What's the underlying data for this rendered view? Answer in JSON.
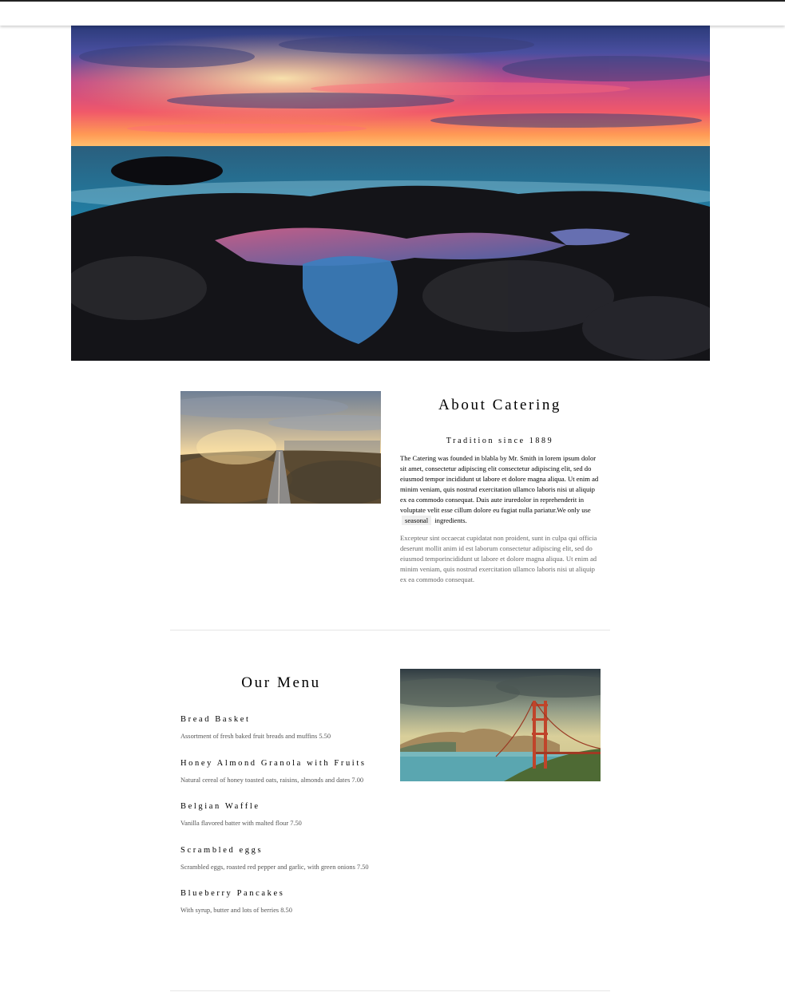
{
  "hero": {
    "image": "sunset-coast-tidepools-photo"
  },
  "about": {
    "image": "city-road-sunrise-photo",
    "title": "About Catering",
    "subtitle": "Tradition since 1889",
    "body_before": "The Catering was founded in blabla by Mr. Smith in lorem ipsum dolor sit amet, consectetur adipiscing elit consectetur adipiscing elit, sed do eiusmod tempor incididunt ut labore et dolore magna aliqua. Ut enim ad minim veniam, quis nostrud exercitation ullamco laboris nisi ut aliquip ex ea commodo consequat. Duis aute iruredolor in reprehenderit in voluptate velit esse cillum dolore eu fugiat nulla pariatur.We only use",
    "body_tag": "seasonal",
    "body_after": "ingredients.",
    "secondary": "Excepteur sint occaecat cupidatat non proident, sunt in culpa qui officia deserunt mollit anim id est laborum consectetur adipiscing elit, sed do eiusmod temporincididunt ut labore et dolore magna aliqua. Ut enim ad minim veniam, quis nostrud exercitation ullamco laboris nisi ut aliquip ex ea commodo consequat."
  },
  "menu": {
    "title": "Our Menu",
    "image": "golden-gate-bridge-photo",
    "items": [
      {
        "name": "Bread Basket",
        "desc": "Assortment of fresh baked fruit breads and muffins 5.50"
      },
      {
        "name": "Honey Almond Granola with Fruits",
        "desc": "Natural cereal of honey toasted oats, raisins, almonds and dates 7.00"
      },
      {
        "name": "Belgian Waffle",
        "desc": "Vanilla flavored batter with malted flour 7.50"
      },
      {
        "name": "Scrambled eggs",
        "desc": "Scrambled eggs, roasted red pepper and garlic, with green onions 7.50"
      },
      {
        "name": "Blueberry Pancakes",
        "desc": "With syrup, butter and lots of berries 8.50"
      }
    ]
  }
}
